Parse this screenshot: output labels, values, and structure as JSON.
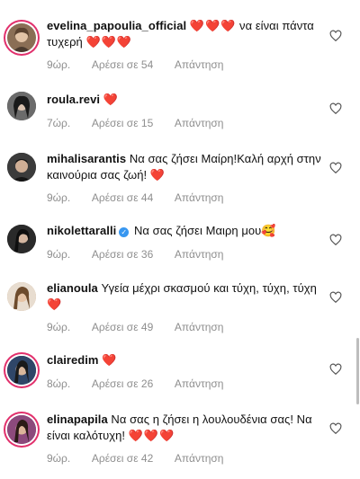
{
  "comments": [
    {
      "username": "evelina_papoulia_official",
      "hearts_before": "❤️❤️❤️",
      "text": "να είναι πάντα τυχερή",
      "hearts_after": "❤️❤️❤️",
      "time": "9ώρ.",
      "likes": "Αρέσει σε 54",
      "reply": "Απάντηση",
      "avatar_color": "#8a6e55",
      "story_ring": true
    },
    {
      "username": "roula.revi",
      "hearts_after": "❤️",
      "time": "7ώρ.",
      "likes": "Αρέσει σε 15",
      "reply": "Απάντηση",
      "avatar_color": "#3a3a3a",
      "story_ring": false
    },
    {
      "username": "mihalisarantis",
      "text": "Να σας ζήσει Μαίρη!Καλή αρχή στην καινούρια σας ζωή!",
      "hearts_after": "❤️",
      "time": "9ώρ.",
      "likes": "Αρέσει σε 44",
      "reply": "Απάντηση",
      "avatar_color": "#2b2b2b",
      "story_ring": false
    },
    {
      "username": "nikolettaralli",
      "verified": true,
      "text": "Να σας ζήσει Μαιρη μου",
      "emoji": "🥰",
      "time": "9ώρ.",
      "likes": "Αρέσει σε 36",
      "reply": "Απάντηση",
      "avatar_color": "#1e1e1e",
      "story_ring": false
    },
    {
      "username": "elianoula",
      "text": "Υγεία μέχρι σκασμού και τύχη, τύχη, τύχη",
      "hearts_after": "❤️",
      "time": "9ώρ.",
      "likes": "Αρέσει σε 49",
      "reply": "Απάντηση",
      "avatar_color": "#c9a27e",
      "story_ring": false
    },
    {
      "username": "clairedim",
      "hearts_after": "❤️",
      "time": "8ώρ.",
      "likes": "Αρέσει σε 26",
      "reply": "Απάντηση",
      "avatar_color": "#24324a",
      "story_ring": true
    },
    {
      "username": "elinapapila",
      "text": "Να σας η ζήσει η λουλουδένια σας! Να είναι καλότυχη!",
      "hearts_after": "❤️❤️❤️",
      "time": "9ώρ.",
      "likes": "Αρέσει σε 42",
      "reply": "Απάντηση",
      "avatar_color": "#7a3a6a",
      "story_ring": true
    }
  ]
}
